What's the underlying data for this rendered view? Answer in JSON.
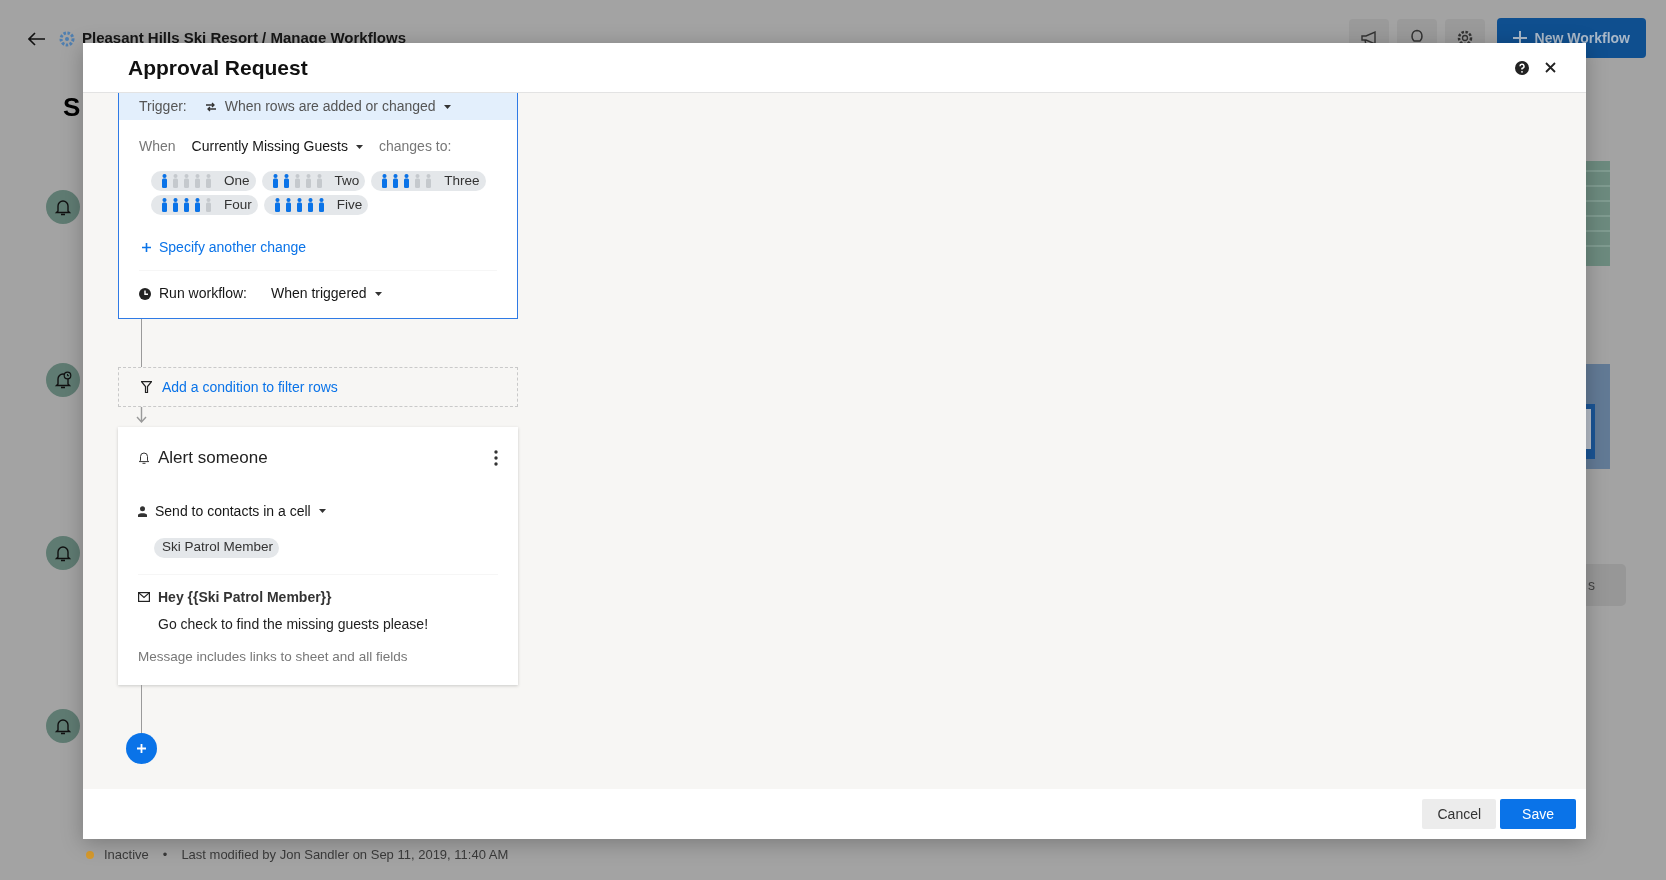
{
  "page": {
    "title": "Pleasant Hills Ski Resort / Manage Workflows",
    "new_button": "New Workflow",
    "heading_fragment": "S",
    "workflows": [
      {
        "kind": "bell"
      },
      {
        "kind": "bell-clock"
      },
      {
        "kind": "bell"
      },
      {
        "kind": "bell"
      }
    ],
    "button_fragment": "s",
    "status": {
      "state": "Inactive",
      "color": "#d69a2d",
      "separator": "•",
      "modified": "Last modified by Jon Sandler on Sep 11, 2019, 11:40 AM"
    }
  },
  "modal": {
    "title": "Approval Request",
    "trigger": {
      "label": "Trigger:",
      "value": "When rows are added or changed"
    },
    "condition": {
      "when": "When",
      "field": "Currently Missing Guests",
      "suffix": "changes to:",
      "options": [
        {
          "label": "One",
          "level": 0.2
        },
        {
          "label": "Two",
          "level": 0.4
        },
        {
          "label": "Three",
          "level": 0.6
        },
        {
          "label": "Four",
          "level": 0.8
        },
        {
          "label": "Five",
          "level": 1
        }
      ],
      "add_link": "Specify another change"
    },
    "run": {
      "label": "Run workflow:",
      "value": "When triggered"
    },
    "filter_link": "Add a condition to filter rows",
    "action": {
      "title": "Alert someone",
      "recipients": "Send to contacts in a cell",
      "contacts": [
        "Ski Patrol Member"
      ],
      "subject": "Hey {{Ski Patrol Member}}",
      "message": "Go check to find the missing guests please!",
      "note": "Message includes links to sheet and all fields"
    },
    "buttons": [
      {
        "label": "Cancel",
        "kind": "secondary"
      },
      {
        "label": "Save",
        "kind": "primary"
      }
    ]
  }
}
